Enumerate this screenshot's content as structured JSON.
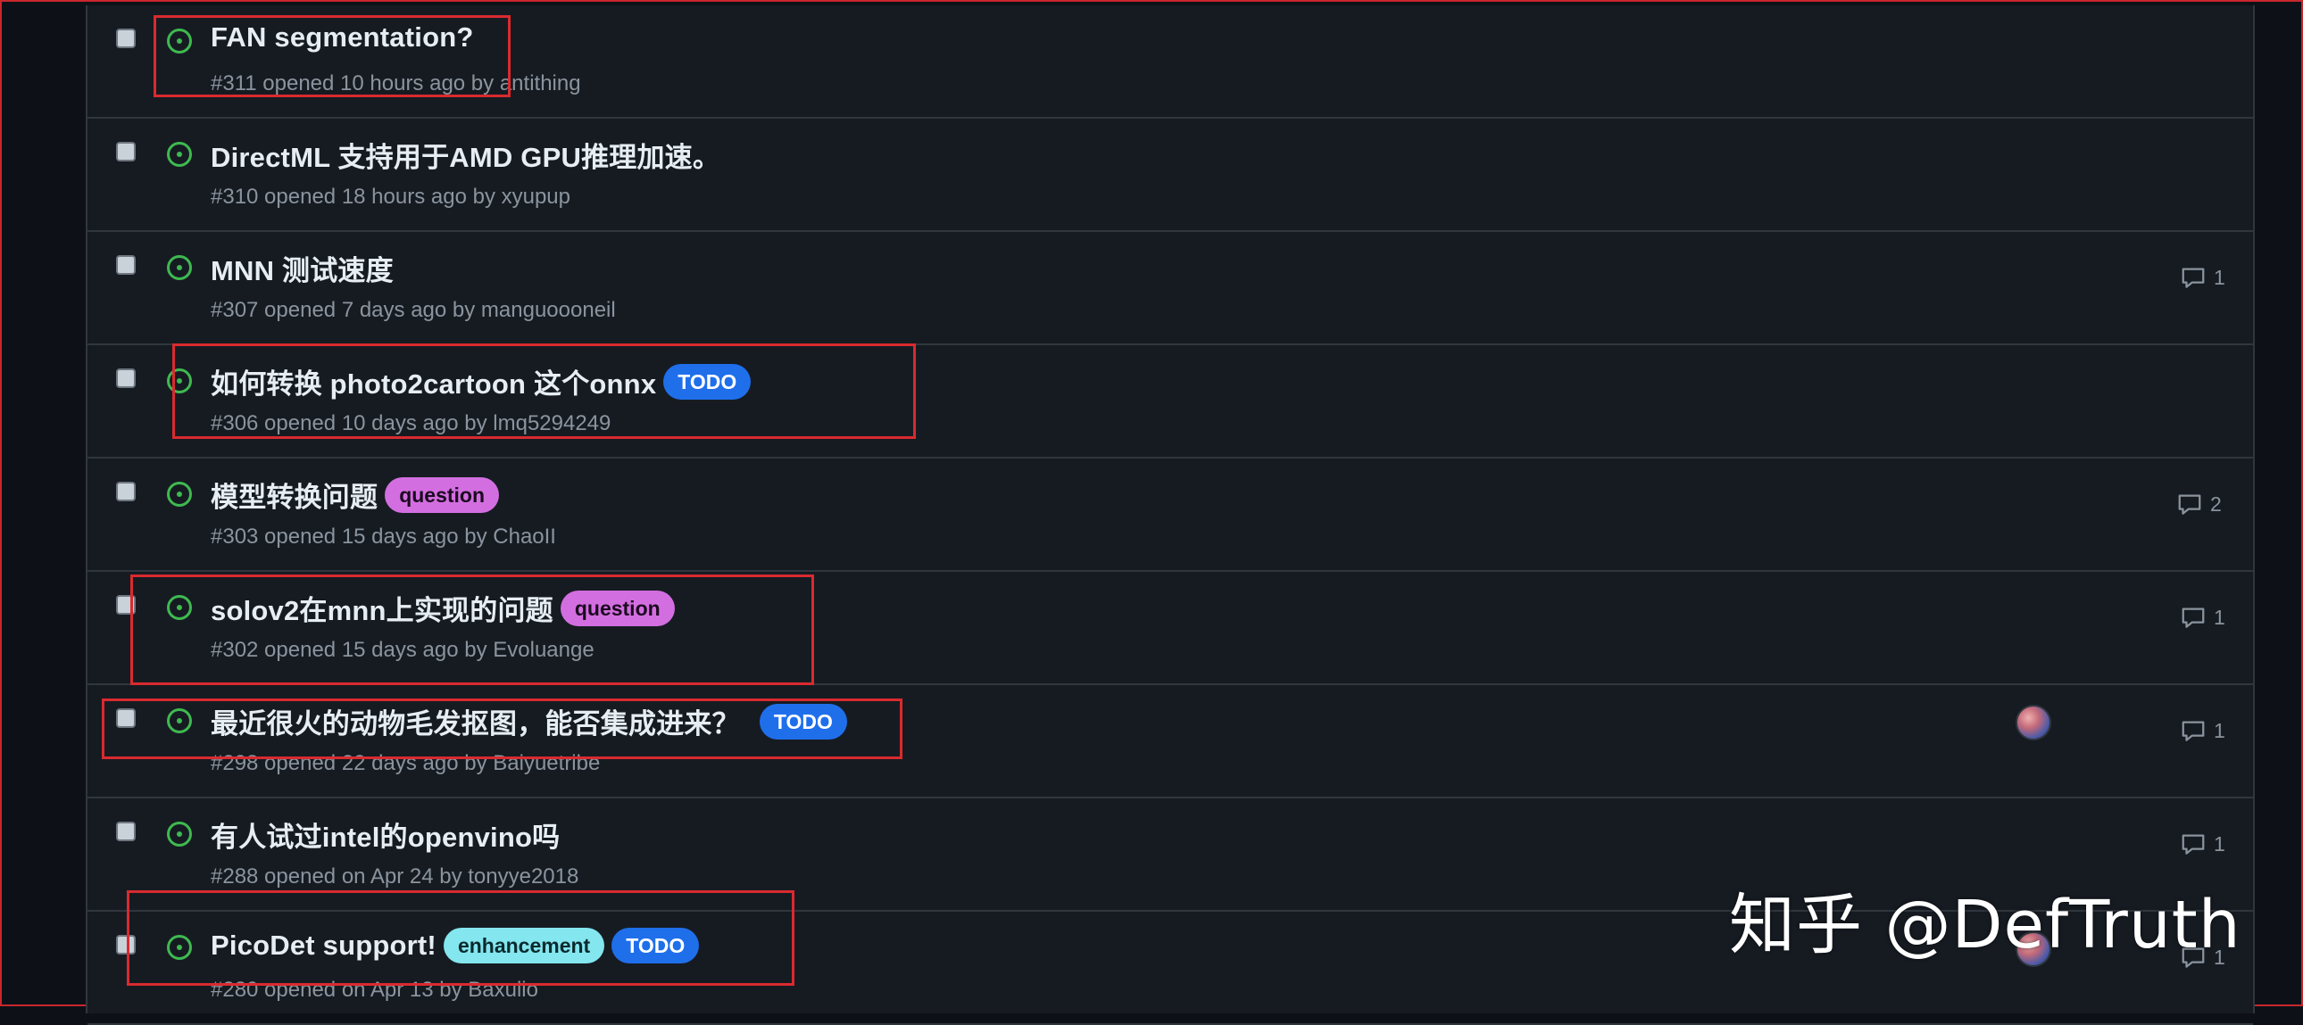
{
  "issues": [
    {
      "title": "FAN segmentation?",
      "meta": "#311 opened 10 hours ago by antithing",
      "labels": [],
      "comments": ""
    },
    {
      "title": "DirectML 支持用于AMD GPU推理加速。",
      "meta": "#310 opened 18 hours ago by xyupup",
      "labels": [],
      "comments": ""
    },
    {
      "title": "MNN 测试速度",
      "meta": "#307 opened 7 days ago by manguoooneil",
      "labels": [],
      "comments": "1"
    },
    {
      "title": "如何转换 photo2cartoon 这个onnx",
      "meta": "#306 opened 10 days ago by lmq5294249",
      "labels": [
        {
          "text": "TODO"
        }
      ],
      "comments": ""
    },
    {
      "title": "模型转换问题",
      "meta": "#303 opened 15 days ago by ChaoII",
      "labels": [
        {
          "text": "question"
        }
      ],
      "comments": "2"
    },
    {
      "title": "solov2在mnn上实现的问题",
      "meta": "#302 opened 15 days ago by Evoluange",
      "labels": [
        {
          "text": "question"
        }
      ],
      "comments": "1"
    },
    {
      "title": "最近很火的动物毛发抠图，能否集成进来？",
      "meta": "#298 opened 22 days ago by Baiyuetribe",
      "labels": [
        {
          "text": "TODO"
        }
      ],
      "comments": "1"
    },
    {
      "title": "有人试过intel的openvino吗",
      "meta": "#288 opened on Apr 24 by tonyye2018",
      "labels": [],
      "comments": "1"
    },
    {
      "title": "PicoDet support!",
      "meta": "#280 opened on Apr 13 by Baxulio",
      "labels": [
        {
          "text": "enhancement"
        },
        {
          "text": "TODO"
        }
      ],
      "comments": "1"
    }
  ],
  "label_colors": {
    "TODO": {
      "bg": "#1f6feb",
      "fg": "#ffffff"
    },
    "question": {
      "bg": "#d36ee0",
      "fg": "#1b0a1f"
    },
    "enhancement": {
      "bg": "#84e6ee",
      "fg": "#0a2a2e"
    }
  },
  "colors": {
    "open_icon": "#3fb950",
    "annotation_box": "#d92a2f",
    "background": "#0d1117",
    "row_background": "#161b22"
  },
  "icons": {
    "open": "issue-opened-icon",
    "comment": "comment-icon"
  },
  "watermark": "知乎 @DefTruth"
}
